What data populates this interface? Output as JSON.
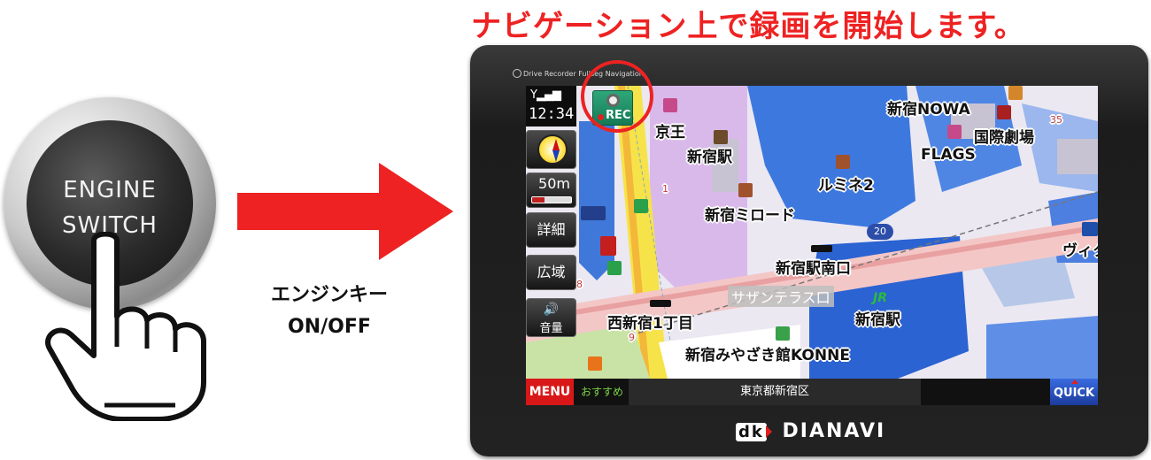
{
  "headline": "ナビゲーション上で録画を開始します。",
  "engine_button": {
    "line1": "ENGINE",
    "line2": "SWITCH"
  },
  "caption": {
    "line1": "エンジンキー",
    "line2": "ON/OFF"
  },
  "device": {
    "top_label": "Drive Recorder Fullseg Navigation",
    "brand": "DIANAVI",
    "brand_mark": "dk"
  },
  "status": {
    "signal_icon": "signal-icon",
    "time": "12:34"
  },
  "sidebar": {
    "scale": "50m",
    "detail_label": "詳細",
    "wide_label": "広域",
    "volume_label": "音量"
  },
  "rec_button": {
    "label": "REC"
  },
  "map_labels": {
    "keio": "京王",
    "shinjuku_nowa": "新宿NOWA",
    "kokusai_gekijo": "国際劇場",
    "flags": "FLAGS",
    "shinjuku_station_1": "新宿駅",
    "lumine2": "ルミネ2",
    "mirode": "新宿ミロード",
    "south_exit": "新宿駅南口",
    "southern_terrace": "サザンテラス口",
    "shinjuku_station_2": "新宿駅",
    "nishi_shinjuku": "西新宿1丁目",
    "konne": "新宿みやざき館KONNE",
    "victoria": "ヴィクト",
    "route_number": "20",
    "block_35": "35",
    "block_9": "9",
    "block_8": "8",
    "block_1": "1"
  },
  "bottombar": {
    "menu_label": "MENU",
    "recommend_label": "おすすめ",
    "address": "東京都新宿区",
    "quick_label": "QUICK"
  },
  "colors": {
    "accent_red": "#ee2222",
    "rec_green": "#1f8f66",
    "map_building_blue": "#2f6bd8",
    "map_road": "#f2c6c6",
    "map_yellow_road": "#f6e34a",
    "map_violet": "#d8b8e8"
  }
}
